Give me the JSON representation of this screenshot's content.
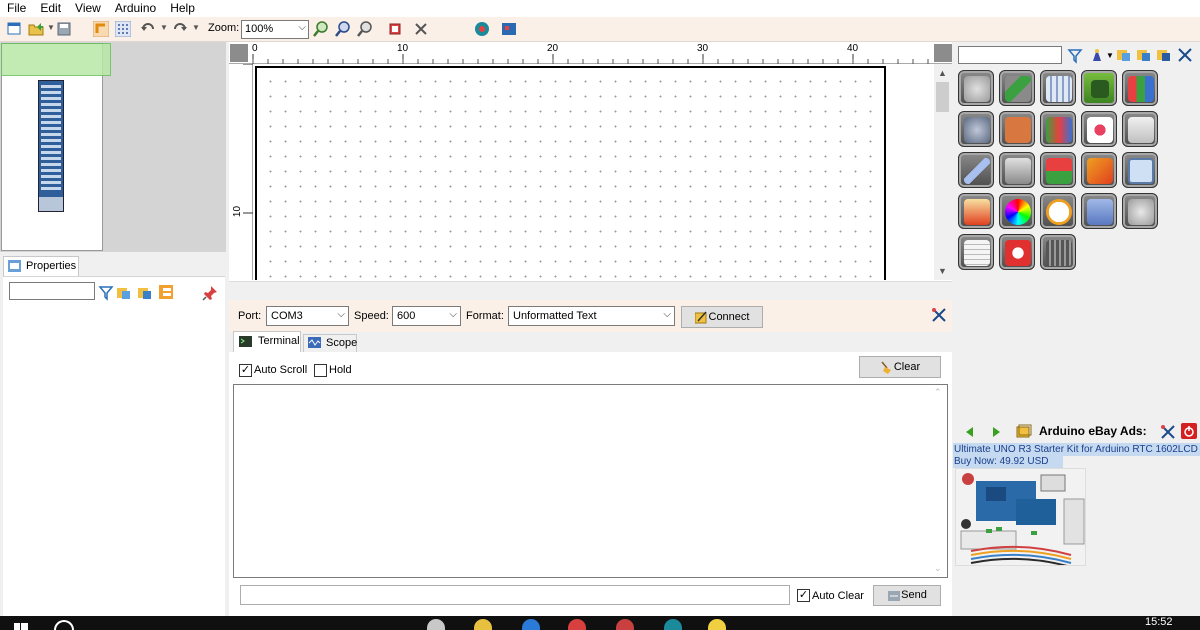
{
  "menu": [
    "File",
    "Edit",
    "View",
    "Arduino",
    "Help"
  ],
  "toolbar": {
    "zoom_label": "Zoom:",
    "zoom_value": "100%",
    "icons": [
      "new-file-icon",
      "open-folder-icon",
      "save-icon",
      "snap-icon",
      "grid-icon",
      "undo-icon",
      "redo-icon",
      "zoom-in-icon",
      "zoom-out-icon",
      "zoom-fit-icon",
      "component-icon",
      "delete-icon",
      "arduino-upload-icon",
      "board-icon"
    ]
  },
  "properties": {
    "tab_label": "Properties",
    "search_value": ""
  },
  "ruler": {
    "top_labels": [
      "0",
      "10",
      "20",
      "30",
      "40"
    ],
    "left_labels": [
      "10"
    ]
  },
  "serial": {
    "port_label": "Port:",
    "port_value": "COM3",
    "speed_label": "Speed:",
    "speed_value": "600",
    "format_label": "Format:",
    "format_value": "Unformatted Text",
    "connect_label": "Connect",
    "tabs": [
      "Terminal",
      "Scope"
    ],
    "auto_scroll_label": "Auto Scroll",
    "auto_scroll_checked": true,
    "hold_label": "Hold",
    "hold_checked": false,
    "clear_label": "Clear",
    "output_text": "",
    "send_input_value": "",
    "auto_clear_label": "Auto Clear",
    "auto_clear_checked": true,
    "send_label": "Send"
  },
  "components": {
    "search_value": "",
    "tiles": [
      "tools",
      "pcb",
      "calculator",
      "chip",
      "number-display",
      "motor",
      "led-segments",
      "counter",
      "keypad",
      "relay",
      "wire",
      "robot",
      "switches",
      "led-array",
      "lcd",
      "graph",
      "color-wheel",
      "clock",
      "panel",
      "servo",
      "notepad",
      "power",
      "dip-switch"
    ]
  },
  "ads": {
    "title": "Arduino eBay Ads:",
    "line1": "Ultimate UNO R3 Starter Kit for Arduino RTC 1602LCD Servo",
    "line2": "Buy Now: 49.92 USD"
  },
  "taskbar": {
    "time": "15:52"
  }
}
